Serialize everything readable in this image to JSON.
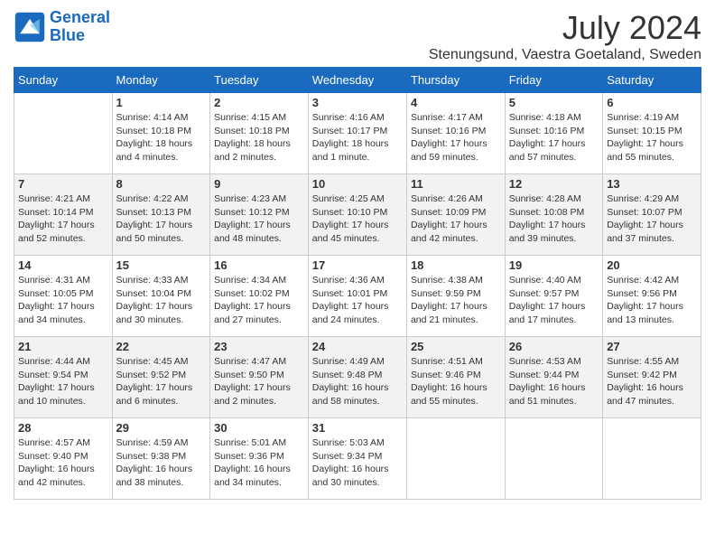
{
  "header": {
    "logo_text_general": "General",
    "logo_text_blue": "Blue",
    "title": "July 2024",
    "subtitle": "Stenungsund, Vaestra Goetaland, Sweden"
  },
  "days_of_week": [
    "Sunday",
    "Monday",
    "Tuesday",
    "Wednesday",
    "Thursday",
    "Friday",
    "Saturday"
  ],
  "weeks": [
    [
      {
        "day": "",
        "info": ""
      },
      {
        "day": "1",
        "info": "Sunrise: 4:14 AM\nSunset: 10:18 PM\nDaylight: 18 hours\nand 4 minutes."
      },
      {
        "day": "2",
        "info": "Sunrise: 4:15 AM\nSunset: 10:18 PM\nDaylight: 18 hours\nand 2 minutes."
      },
      {
        "day": "3",
        "info": "Sunrise: 4:16 AM\nSunset: 10:17 PM\nDaylight: 18 hours\nand 1 minute."
      },
      {
        "day": "4",
        "info": "Sunrise: 4:17 AM\nSunset: 10:16 PM\nDaylight: 17 hours\nand 59 minutes."
      },
      {
        "day": "5",
        "info": "Sunrise: 4:18 AM\nSunset: 10:16 PM\nDaylight: 17 hours\nand 57 minutes."
      },
      {
        "day": "6",
        "info": "Sunrise: 4:19 AM\nSunset: 10:15 PM\nDaylight: 17 hours\nand 55 minutes."
      }
    ],
    [
      {
        "day": "7",
        "info": "Sunrise: 4:21 AM\nSunset: 10:14 PM\nDaylight: 17 hours\nand 52 minutes."
      },
      {
        "day": "8",
        "info": "Sunrise: 4:22 AM\nSunset: 10:13 PM\nDaylight: 17 hours\nand 50 minutes."
      },
      {
        "day": "9",
        "info": "Sunrise: 4:23 AM\nSunset: 10:12 PM\nDaylight: 17 hours\nand 48 minutes."
      },
      {
        "day": "10",
        "info": "Sunrise: 4:25 AM\nSunset: 10:10 PM\nDaylight: 17 hours\nand 45 minutes."
      },
      {
        "day": "11",
        "info": "Sunrise: 4:26 AM\nSunset: 10:09 PM\nDaylight: 17 hours\nand 42 minutes."
      },
      {
        "day": "12",
        "info": "Sunrise: 4:28 AM\nSunset: 10:08 PM\nDaylight: 17 hours\nand 39 minutes."
      },
      {
        "day": "13",
        "info": "Sunrise: 4:29 AM\nSunset: 10:07 PM\nDaylight: 17 hours\nand 37 minutes."
      }
    ],
    [
      {
        "day": "14",
        "info": "Sunrise: 4:31 AM\nSunset: 10:05 PM\nDaylight: 17 hours\nand 34 minutes."
      },
      {
        "day": "15",
        "info": "Sunrise: 4:33 AM\nSunset: 10:04 PM\nDaylight: 17 hours\nand 30 minutes."
      },
      {
        "day": "16",
        "info": "Sunrise: 4:34 AM\nSunset: 10:02 PM\nDaylight: 17 hours\nand 27 minutes."
      },
      {
        "day": "17",
        "info": "Sunrise: 4:36 AM\nSunset: 10:01 PM\nDaylight: 17 hours\nand 24 minutes."
      },
      {
        "day": "18",
        "info": "Sunrise: 4:38 AM\nSunset: 9:59 PM\nDaylight: 17 hours\nand 21 minutes."
      },
      {
        "day": "19",
        "info": "Sunrise: 4:40 AM\nSunset: 9:57 PM\nDaylight: 17 hours\nand 17 minutes."
      },
      {
        "day": "20",
        "info": "Sunrise: 4:42 AM\nSunset: 9:56 PM\nDaylight: 17 hours\nand 13 minutes."
      }
    ],
    [
      {
        "day": "21",
        "info": "Sunrise: 4:44 AM\nSunset: 9:54 PM\nDaylight: 17 hours\nand 10 minutes."
      },
      {
        "day": "22",
        "info": "Sunrise: 4:45 AM\nSunset: 9:52 PM\nDaylight: 17 hours\nand 6 minutes."
      },
      {
        "day": "23",
        "info": "Sunrise: 4:47 AM\nSunset: 9:50 PM\nDaylight: 17 hours\nand 2 minutes."
      },
      {
        "day": "24",
        "info": "Sunrise: 4:49 AM\nSunset: 9:48 PM\nDaylight: 16 hours\nand 58 minutes."
      },
      {
        "day": "25",
        "info": "Sunrise: 4:51 AM\nSunset: 9:46 PM\nDaylight: 16 hours\nand 55 minutes."
      },
      {
        "day": "26",
        "info": "Sunrise: 4:53 AM\nSunset: 9:44 PM\nDaylight: 16 hours\nand 51 minutes."
      },
      {
        "day": "27",
        "info": "Sunrise: 4:55 AM\nSunset: 9:42 PM\nDaylight: 16 hours\nand 47 minutes."
      }
    ],
    [
      {
        "day": "28",
        "info": "Sunrise: 4:57 AM\nSunset: 9:40 PM\nDaylight: 16 hours\nand 42 minutes."
      },
      {
        "day": "29",
        "info": "Sunrise: 4:59 AM\nSunset: 9:38 PM\nDaylight: 16 hours\nand 38 minutes."
      },
      {
        "day": "30",
        "info": "Sunrise: 5:01 AM\nSunset: 9:36 PM\nDaylight: 16 hours\nand 34 minutes."
      },
      {
        "day": "31",
        "info": "Sunrise: 5:03 AM\nSunset: 9:34 PM\nDaylight: 16 hours\nand 30 minutes."
      },
      {
        "day": "",
        "info": ""
      },
      {
        "day": "",
        "info": ""
      },
      {
        "day": "",
        "info": ""
      }
    ]
  ]
}
